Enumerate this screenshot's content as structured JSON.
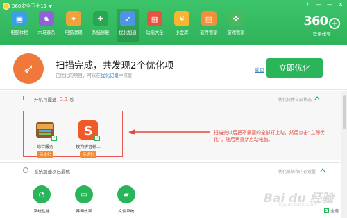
{
  "window": {
    "title": "360安全卫士11",
    "controls": [
      "♗",
      "—",
      "—",
      "✕"
    ]
  },
  "nav": [
    {
      "label": "电脑体检",
      "icon": "monitor-icon",
      "color": "#39a0e6",
      "glyph": "▣"
    },
    {
      "label": "木马查杀",
      "icon": "horse-icon",
      "color": "#8d63d6",
      "glyph": "♞"
    },
    {
      "label": "电脑清理",
      "icon": "broom-icon",
      "color": "#f2a23a",
      "glyph": "✦"
    },
    {
      "label": "系统修复",
      "icon": "shield-icon",
      "color": "#27a84f",
      "glyph": "✚"
    },
    {
      "label": "优化加速",
      "icon": "rocket-icon",
      "color": "#4f95e5",
      "glyph": "➶"
    },
    {
      "label": "功能大全",
      "icon": "grid-icon",
      "color": "#e6533f",
      "glyph": "▦"
    },
    {
      "label": "小金库",
      "icon": "coin-icon",
      "color": "#f7b530",
      "glyph": "¥"
    },
    {
      "label": "软件管家",
      "icon": "apps-icon",
      "color": "#f0903d",
      "glyph": "▤"
    },
    {
      "label": "游戏管家",
      "icon": "gamepad-icon",
      "color": "#47b95f",
      "glyph": "✜"
    }
  ],
  "brand": {
    "logo": "360",
    "sub": "登录帐号"
  },
  "summary": {
    "title": "扫描完成，共发现2个优化项",
    "sub_prefix": "已优化的项目，可以在",
    "sub_link": "优化记录",
    "sub_suffix": "中恢复",
    "return_link": "返回",
    "button": "立即优化"
  },
  "section1": {
    "label_prefix": "开机可提速",
    "speed": "0.1",
    "unit": "秒",
    "right": "优化软件自启状态",
    "apps": [
      {
        "name": "综合服务",
        "badge": "待优化",
        "icon": "wallet-icon"
      },
      {
        "name": "搜狗拼音输...",
        "badge": "待优化",
        "icon": "sogou-icon"
      }
    ]
  },
  "annotation": "扫描完以后把不需要的全部打上勾，然后点击“立即优化”，随后再重新启动电脑。",
  "section2": {
    "label": "系统加速项已最优",
    "right": "优化系统和内存设置",
    "items": [
      {
        "name": "系统性能",
        "icon": "gauge-icon",
        "glyph": "◔"
      },
      {
        "name": "界面效果",
        "icon": "monitor-icon",
        "glyph": "▭"
      },
      {
        "name": "文件系统",
        "icon": "folder-icon",
        "glyph": "▰"
      }
    ],
    "select_all": "全选"
  },
  "watermark": {
    "main": "Bai du 经验",
    "sub": "jingyan.baidu.com"
  }
}
